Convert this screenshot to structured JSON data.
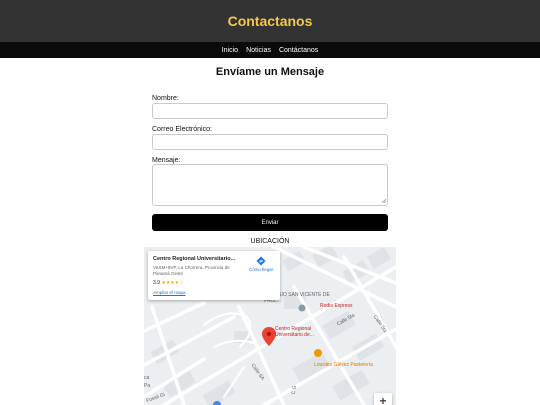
{
  "header": {
    "title": "Contactanos"
  },
  "nav": {
    "items": [
      "Inicio",
      "Noticias",
      "Contáctanos"
    ]
  },
  "form": {
    "title": "Envíame un Mensaje",
    "name_label": "Nombre:",
    "email_label": "Correo Electrónico:",
    "message_label": "Mensaje:",
    "submit_label": "Enviar"
  },
  "location": {
    "heading": "UBICACIÓN",
    "card": {
      "place_name": "Centro Regional Universitario...",
      "address": "V6XM+9VP, La Chorrera, Provincia de Panamá Oeste",
      "rating": "3.9",
      "stars": "★★★★☆",
      "map_link": "Ampliar el mapa",
      "directions_label": "Cómo llegar"
    },
    "labels": {
      "school": "COLEGIO SAN VICENTE DE PAUL...",
      "express": "Rodia Express",
      "centro": "Centro Regional Universitario de...",
      "bakery": "Lourdes Gálvez Pastelería",
      "calle_5ta_a": "Calle 5ta",
      "calle_5ta_b": "Calle 5ta",
      "calle_6a": "Calle 6A",
      "calle_c": "C G",
      "fossil": "Fossil Gi",
      "left_a": "ca",
      "left_b": "Pa"
    },
    "zoom_in": "+"
  },
  "colors": {
    "header_bg": "#333333",
    "brand": "#f2c94c",
    "nav_bg": "#0a0a0a",
    "button_bg": "#000000",
    "pin": "#ea4335"
  }
}
